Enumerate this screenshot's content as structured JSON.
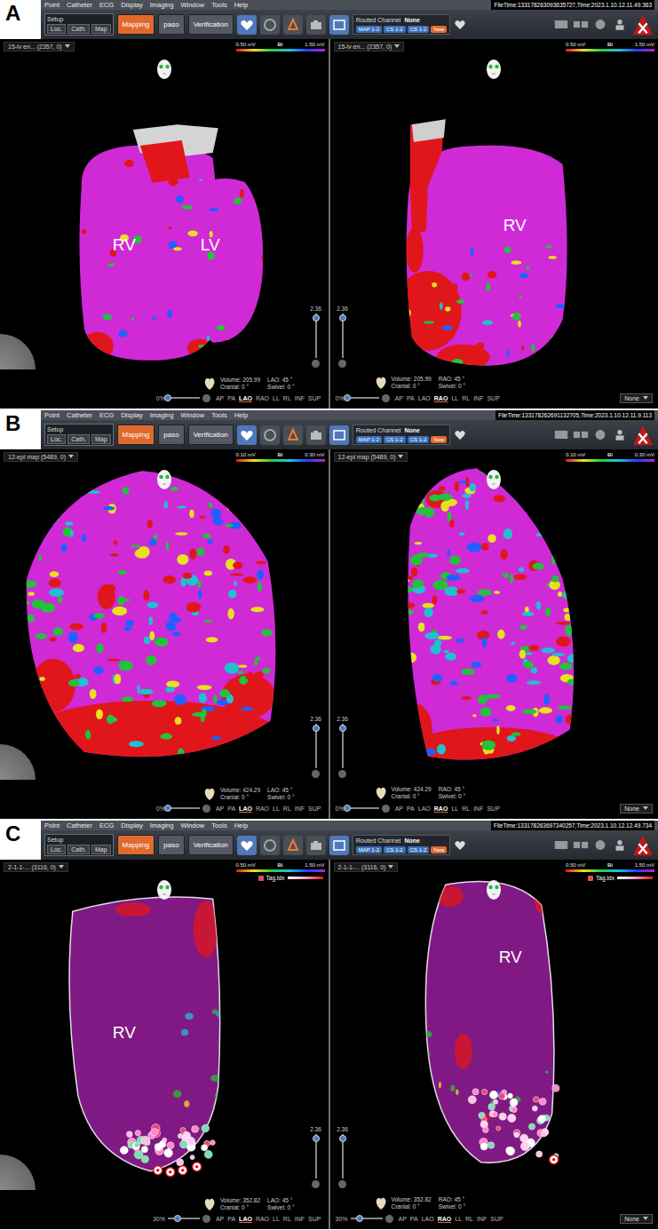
{
  "toolbar": {
    "menu": [
      "Point",
      "Catheter",
      "ECG",
      "Display",
      "Imaging",
      "Window",
      "Tools",
      "Help"
    ],
    "setup": "Setup",
    "setup_tabs": [
      "Loc.",
      "Cath.",
      "Map"
    ],
    "modes": [
      {
        "label": "Mapping",
        "selected": true
      },
      {
        "label": "paso",
        "selected": false
      },
      {
        "label": "Verification",
        "selected": false
      }
    ],
    "routed_label": "Routed Channel",
    "routed_value": "None",
    "channels": [
      "MAP 1-2",
      "CS 1-2",
      "CS 1-2",
      "New"
    ]
  },
  "panels": [
    {
      "letter": "A",
      "file_time": "FileTime:133178263093635727,Time:2023.1.10.12.11.49.363",
      "view_selector": "None",
      "views": [
        {
          "title": "15-lv en... (2357, 0)",
          "scale": {
            "min": "0.50 mV",
            "mode": "Bi",
            "max": "1.50 mV"
          },
          "labels": [
            {
              "text": "RV"
            },
            {
              "text": "LV"
            }
          ],
          "slider_value": "2.36",
          "slider_level": 0.9,
          "volume": "Volume: 205.99",
          "angle": "LAO: 45 °",
          "cranial": "Cranial: 0 °",
          "swivel": "Swivel: 0 °",
          "opacity": "0%",
          "opacity_level": 0,
          "view_buttons": [
            {
              "label": "AP",
              "selected": false
            },
            {
              "label": "PA",
              "selected": false
            },
            {
              "label": "LAO",
              "selected": true
            },
            {
              "label": "RAO",
              "selected": false
            },
            {
              "label": "LL",
              "selected": false
            },
            {
              "label": "RL",
              "selected": false
            },
            {
              "label": "INF",
              "selected": false
            },
            {
              "label": "SUP",
              "selected": false
            }
          ]
        },
        {
          "title": "15-lv en... (2357, 0)",
          "scale": {
            "min": "0.50 mV",
            "mode": "Bi",
            "max": "1.50 mV"
          },
          "labels": [
            {
              "text": "RV"
            }
          ],
          "slider_value": "2.36",
          "slider_level": 0.9,
          "volume": "Volume: 205.99",
          "angle": "RAO: 45 °",
          "cranial": "Cranial: 0 °",
          "swivel": "Swivel: 0 °",
          "opacity": "0%",
          "opacity_level": 0,
          "view_buttons": [
            {
              "label": "AP",
              "selected": false
            },
            {
              "label": "PA",
              "selected": false
            },
            {
              "label": "LAO",
              "selected": false
            },
            {
              "label": "RAO",
              "selected": true
            },
            {
              "label": "LL",
              "selected": false
            },
            {
              "label": "RL",
              "selected": false
            },
            {
              "label": "INF",
              "selected": false
            },
            {
              "label": "SUP",
              "selected": false
            }
          ]
        }
      ]
    },
    {
      "letter": "B",
      "file_time": "FileTime:133178262691132705,Time:2023.1.10.12.11.9.113",
      "view_selector": "None",
      "views": [
        {
          "title": "12-epi map (5489, 0)",
          "scale": {
            "min": "0.10 mV",
            "mode": "Bi",
            "max": "0.30 mV"
          },
          "labels": [],
          "slider_value": "2.36",
          "slider_level": 0.9,
          "volume": "Volume: 424.29",
          "angle": "LAO: 45 °",
          "cranial": "Cranial: 0 °",
          "swivel": "Swivel: 0 °",
          "opacity": "0%",
          "opacity_level": 0,
          "view_buttons": [
            {
              "label": "AP",
              "selected": false
            },
            {
              "label": "PA",
              "selected": false
            },
            {
              "label": "LAO",
              "selected": true
            },
            {
              "label": "RAO",
              "selected": false
            },
            {
              "label": "LL",
              "selected": false
            },
            {
              "label": "RL",
              "selected": false
            },
            {
              "label": "INF",
              "selected": false
            },
            {
              "label": "SUP",
              "selected": false
            }
          ]
        },
        {
          "title": "12-epi map (5489, 0)",
          "scale": {
            "min": "0.10 mV",
            "mode": "Bi",
            "max": "0.30 mV"
          },
          "labels": [],
          "slider_value": "2.36",
          "slider_level": 0.9,
          "volume": "Volume: 424.29",
          "angle": "RAO: 45 °",
          "cranial": "Cranial: 0 °",
          "swivel": "Swivel: 0 °",
          "opacity": "0%",
          "opacity_level": 0,
          "view_buttons": [
            {
              "label": "AP",
              "selected": false
            },
            {
              "label": "PA",
              "selected": false
            },
            {
              "label": "LAO",
              "selected": false
            },
            {
              "label": "RAO",
              "selected": true
            },
            {
              "label": "LL",
              "selected": false
            },
            {
              "label": "RL",
              "selected": false
            },
            {
              "label": "INF",
              "selected": false
            },
            {
              "label": "SUP",
              "selected": false
            }
          ]
        }
      ]
    },
    {
      "letter": "C",
      "file_time": "FileTime:133178263697340257,Time:2023.1.10.12.12.49.734",
      "view_selector": "None",
      "views": [
        {
          "title": "2-1-1-... (3116, 0)",
          "scale": {
            "min": "0.50 mV",
            "mode": "Bi",
            "max": "1.50 mV"
          },
          "tag_label": "Tag.Idx",
          "labels": [
            {
              "text": "RV"
            }
          ],
          "slider_value": "2.36",
          "slider_level": 0.9,
          "volume": "Volume: 352.82",
          "angle": "LAO: 45 °",
          "cranial": "Cranial: 0 °",
          "swivel": "Swivel: 0 °",
          "opacity": "30%",
          "opacity_level": 0.3,
          "view_buttons": [
            {
              "label": "AP",
              "selected": false
            },
            {
              "label": "PA",
              "selected": false
            },
            {
              "label": "LAO",
              "selected": true
            },
            {
              "label": "RAO",
              "selected": false
            },
            {
              "label": "LL",
              "selected": false
            },
            {
              "label": "RL",
              "selected": false
            },
            {
              "label": "INF",
              "selected": false
            },
            {
              "label": "SUP",
              "selected": false
            }
          ]
        },
        {
          "title": "2-1-1-... (3116, 0)",
          "scale": {
            "min": "0.50 mV",
            "mode": "Bi",
            "max": "1.50 mV"
          },
          "tag_label": "Tag.Idx",
          "labels": [
            {
              "text": "RV"
            }
          ],
          "slider_value": "2.36",
          "slider_level": 0.9,
          "volume": "Volume: 352.82",
          "angle": "RAO: 45 °",
          "cranial": "Cranial: 0 °",
          "swivel": "Swivel: 0 °",
          "opacity": "30%",
          "opacity_level": 0.3,
          "view_buttons": [
            {
              "label": "AP",
              "selected": false
            },
            {
              "label": "PA",
              "selected": false
            },
            {
              "label": "LAO",
              "selected": false
            },
            {
              "label": "RAO",
              "selected": true
            },
            {
              "label": "LL",
              "selected": false
            },
            {
              "label": "RL",
              "selected": false
            },
            {
              "label": "INF",
              "selected": false
            },
            {
              "label": "SUP",
              "selected": false
            }
          ]
        }
      ]
    }
  ]
}
